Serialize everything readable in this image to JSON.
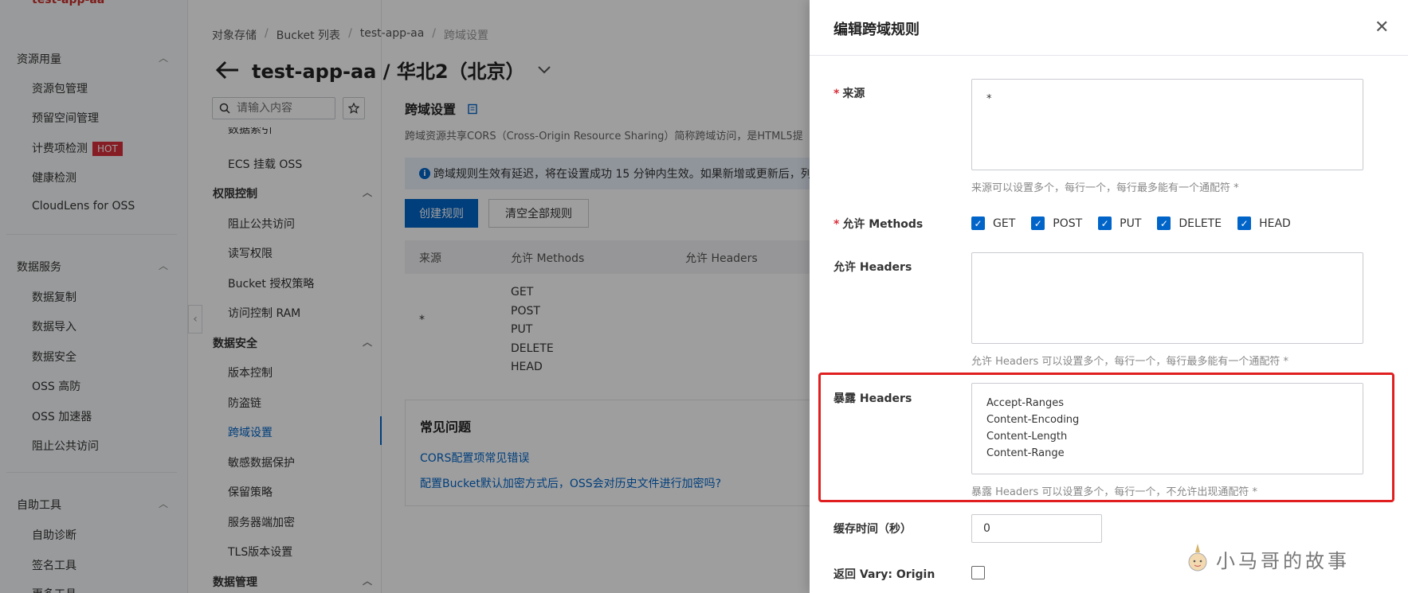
{
  "leftnav": {
    "app_name": "test-app-aa",
    "groups": [
      {
        "title": "资源用量",
        "items": [
          "资源包管理",
          "预留空间管理",
          "计费项检测",
          "健康检测",
          "CloudLens for OSS"
        ]
      },
      {
        "title": "数据服务",
        "items": [
          "数据复制",
          "数据导入",
          "数据安全",
          "OSS 高防",
          "OSS 加速器",
          "阻止公共访问"
        ]
      },
      {
        "title": "自助工具",
        "items": [
          "自助诊断",
          "签名工具",
          "更多工具"
        ]
      }
    ],
    "hot_badge": "HOT"
  },
  "subnav": {
    "search_placeholder": "请输入内容",
    "cut_item": "数据索引",
    "item_ecs": "ECS 挂载 OSS",
    "groups": {
      "perm": {
        "title": "权限控制",
        "items": [
          "阻止公共访问",
          "读写权限",
          "Bucket 授权策略",
          "访问控制 RAM"
        ]
      },
      "security": {
        "title": "数据安全",
        "items": [
          "版本控制",
          "防盗链",
          "跨域设置",
          "敏感数据保护",
          "保留策略",
          "服务器端加密",
          "TLS版本设置"
        ]
      },
      "manage": {
        "title": "数据管理"
      }
    }
  },
  "main": {
    "breadcrumb": [
      "对象存储",
      "Bucket 列表",
      "test-app-aa",
      "跨域设置"
    ],
    "page_title": "test-app-aa / 华北2（北京）",
    "section_title": "跨域设置",
    "section_desc": "跨域资源共享CORS（Cross-Origin Resource Sharing）简称跨域访问，是HTML5提",
    "notice": "跨域规则生效有延迟，将在设置成功 15 分钟内生效。如果新增或更新后，列",
    "create_rule": "创建规则",
    "clear_rules": "清空全部规则",
    "table": {
      "headers": [
        "来源",
        "允许 Methods",
        "允许 Headers"
      ],
      "rows": [
        {
          "origin": "*",
          "methods": [
            "GET",
            "POST",
            "PUT",
            "DELETE",
            "HEAD"
          ]
        }
      ]
    },
    "faq": {
      "title": "常见问题",
      "links": [
        "CORS配置项常见错误",
        "配置Bucket默认加密方式后，OSS会对历史文件进行加密吗?"
      ]
    }
  },
  "drawer": {
    "title": "编辑跨域规则",
    "origin_label": "来源",
    "origin_value": "*",
    "origin_help": "来源可以设置多个，每行一个，每行最多能有一个通配符 *",
    "methods_label": "允许 Methods",
    "methods": [
      "GET",
      "POST",
      "PUT",
      "DELETE",
      "HEAD"
    ],
    "allow_headers_label": "允许 Headers",
    "allow_headers_value": "",
    "allow_headers_help": "允许 Headers 可以设置多个，每行一个，每行最多能有一个通配符 *",
    "expose_headers_label": "暴露 Headers",
    "expose_headers_value": "Accept-Ranges\nContent-Encoding\nContent-Length\nContent-Range",
    "expose_headers_help": "暴露 Headers 可以设置多个，每行一个，不允许出现通配符 *",
    "cache_label": "缓存时间（秒）",
    "cache_value": "0",
    "vary_label": "返回 Vary: Origin"
  },
  "watermark": "小马哥的故事",
  "colors": {
    "accent": "#0064c8",
    "highlight": "#e02020",
    "hot": "#d9303b"
  }
}
